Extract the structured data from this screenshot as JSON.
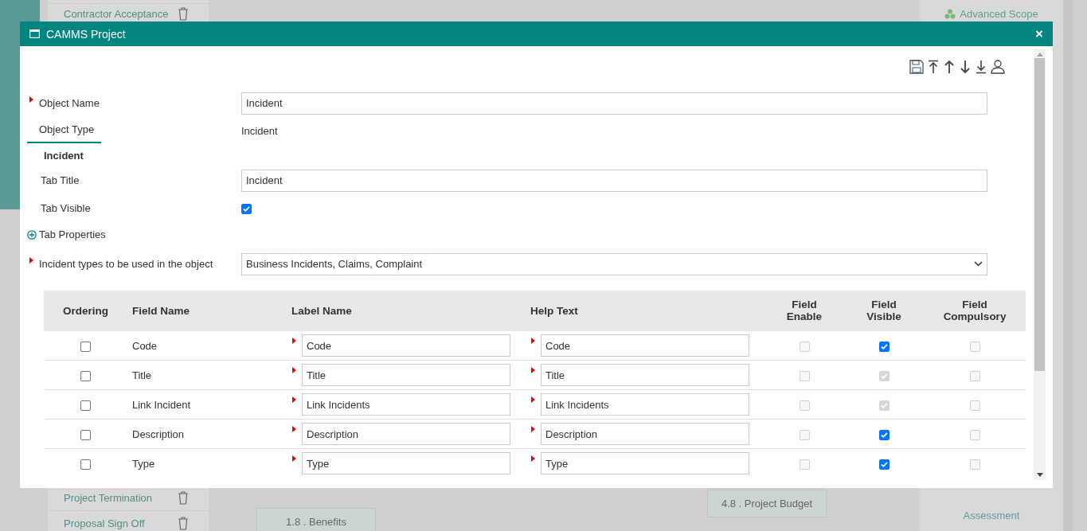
{
  "background": {
    "sidebar_items": [
      "Contractor Acceptance",
      "Project Termination",
      "Proposal Sign Off"
    ],
    "flow_steps": [
      "1.8 . Benefits",
      "4.8 . Project Budget"
    ],
    "side_links": [
      "Advanced Scope",
      "Assessment"
    ]
  },
  "window": {
    "title": "CAMMS Project",
    "close": "×"
  },
  "form": {
    "object_name": {
      "label": "Object Name",
      "required": true,
      "value": "Incident"
    },
    "object_type": {
      "label": "Object Type",
      "value": "Incident",
      "selected": true
    },
    "section_title": "Incident",
    "tab_title": {
      "label": "Tab Title",
      "value": "Incident"
    },
    "tab_visible": {
      "label": "Tab Visible",
      "checked": true
    },
    "tab_properties": {
      "label": "Tab Properties",
      "expanded": false
    },
    "incident_types": {
      "label": "Incident types to be used in the object",
      "required": true,
      "value": "Business Incidents, Claims, Complaint"
    }
  },
  "table": {
    "columns": [
      "Ordering",
      "Field Name",
      "Label Name",
      "Help Text",
      "Field Enable",
      "Field Visible",
      "Field Compulsory"
    ],
    "rows": [
      {
        "ordering": false,
        "field_name": "Code",
        "label_name": "Code",
        "help_text": "Code",
        "enable": {
          "checked": false,
          "disabled": true
        },
        "visible": {
          "checked": true,
          "disabled": false
        },
        "compulsory": {
          "checked": false,
          "disabled": true
        }
      },
      {
        "ordering": false,
        "field_name": "Title",
        "label_name": "Title",
        "help_text": "Title",
        "enable": {
          "checked": false,
          "disabled": true
        },
        "visible": {
          "checked": true,
          "disabled": true
        },
        "compulsory": {
          "checked": false,
          "disabled": true
        }
      },
      {
        "ordering": false,
        "field_name": "Link Incident",
        "label_name": "Link Incidents",
        "help_text": "Link Incidents",
        "enable": {
          "checked": false,
          "disabled": true
        },
        "visible": {
          "checked": true,
          "disabled": true
        },
        "compulsory": {
          "checked": false,
          "disabled": true
        }
      },
      {
        "ordering": false,
        "field_name": "Description",
        "label_name": "Description",
        "help_text": "Description",
        "enable": {
          "checked": false,
          "disabled": true
        },
        "visible": {
          "checked": true,
          "disabled": false
        },
        "compulsory": {
          "checked": false,
          "disabled": true
        }
      },
      {
        "ordering": false,
        "field_name": "Type",
        "label_name": "Type",
        "help_text": "Type",
        "enable": {
          "checked": false,
          "disabled": true
        },
        "visible": {
          "checked": true,
          "disabled": false
        },
        "compulsory": {
          "checked": false,
          "disabled": true
        }
      }
    ]
  }
}
